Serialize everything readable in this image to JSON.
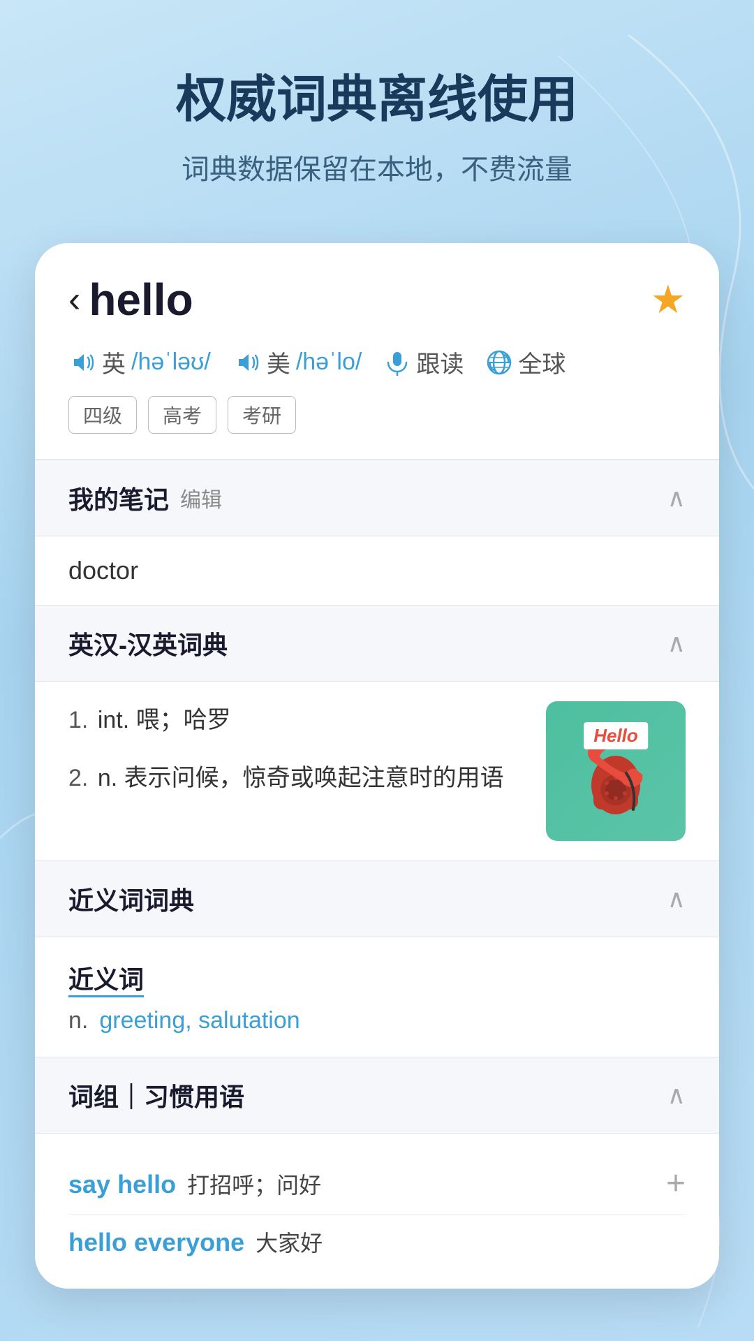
{
  "header": {
    "title": "权威词典离线使用",
    "subtitle": "词典数据保留在本地，不费流量"
  },
  "word": {
    "back_label": "‹",
    "word": "hello",
    "is_starred": true,
    "phonetics": {
      "uk_label": "英",
      "uk_ipa": "/həˈləʊ/",
      "us_label": "美",
      "us_ipa": "/həˈlo/",
      "follow_label": "跟读",
      "global_label": "全球"
    },
    "tags": [
      "四级",
      "高考",
      "考研"
    ]
  },
  "sections": {
    "notes": {
      "title": "我的笔记",
      "edit_label": "编辑",
      "content": "doctor"
    },
    "dictionary": {
      "title": "英汉-汉英词典",
      "entries": [
        {
          "num": "1.",
          "pos": "int.",
          "definition": "喂；哈罗"
        },
        {
          "num": "2.",
          "pos": "n.",
          "definition": "表示问候，惊奇或唤起注意时的用语"
        }
      ],
      "image_label": "Hello"
    },
    "synonyms": {
      "title": "近义词词典",
      "synonym_title": "近义词",
      "pos": "n.",
      "words": "greeting, salutation"
    },
    "phrases": {
      "title": "词组｜习惯用语",
      "items": [
        {
          "word": "say hello",
          "meaning": "打招呼；问好",
          "has_add": true
        },
        {
          "word": "hello everyone",
          "meaning": "大家好",
          "has_add": false
        }
      ]
    }
  }
}
